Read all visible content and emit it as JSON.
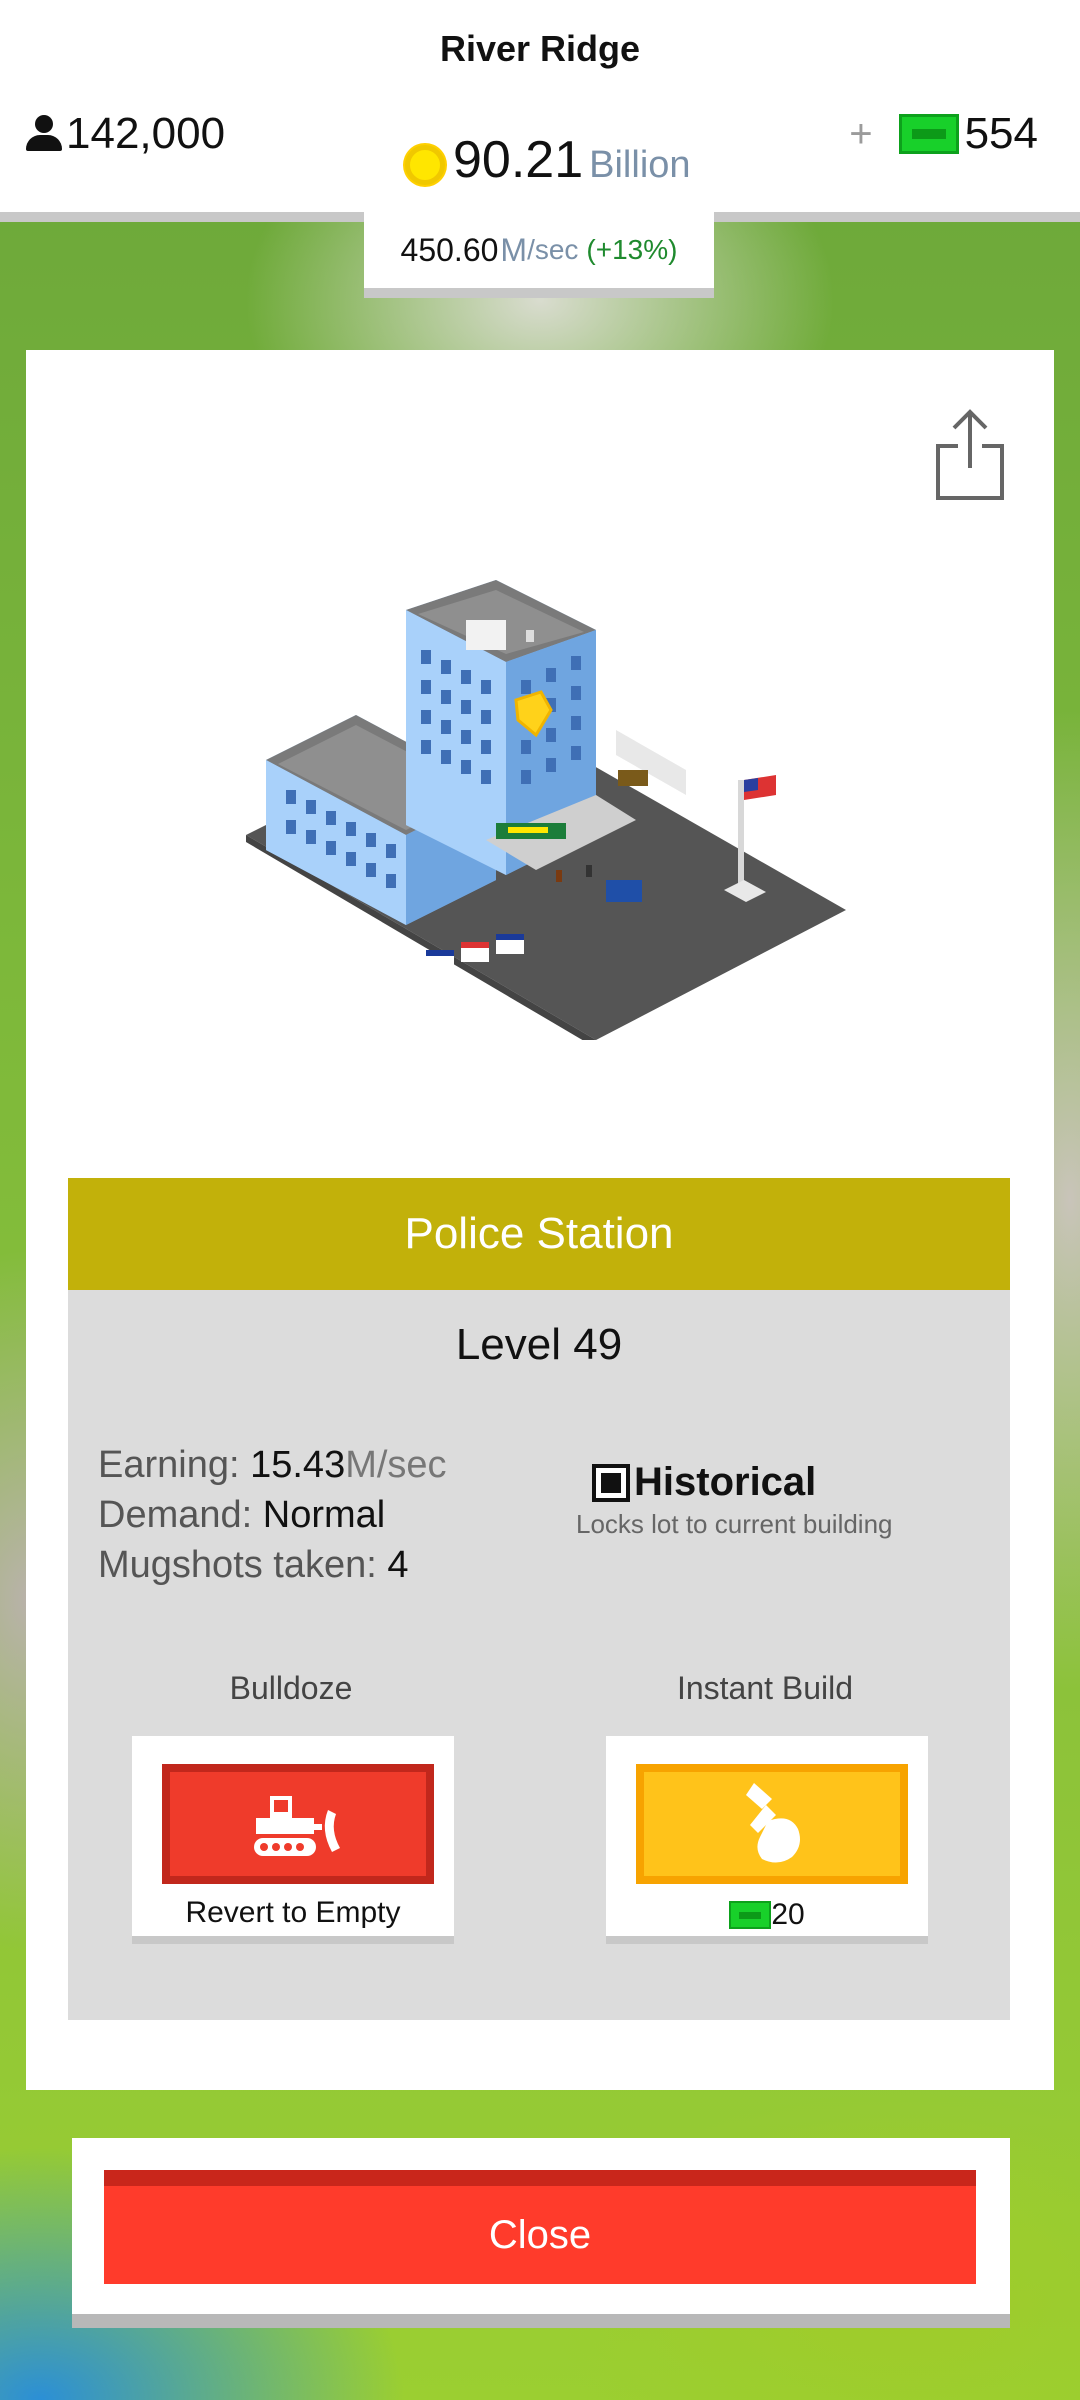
{
  "header": {
    "city_name": "River Ridge",
    "population": "142,000",
    "money_amount": "90.21",
    "money_unit": "Billion",
    "cash": "554",
    "cash_plus": "+",
    "rate_value": "450.60",
    "rate_unit": "M",
    "rate_suffix": "/sec",
    "rate_bonus": "(+13%)"
  },
  "building": {
    "name": "Police Station",
    "level": "Level 49",
    "earning_label": "Earning:",
    "earning_value": "15.43",
    "earning_unit": "M/sec",
    "demand_label": "Demand:",
    "demand_value": "Normal",
    "mugshots_label": "Mugshots taken:",
    "mugshots_value": "4",
    "historical_label": "Historical",
    "historical_desc": "Locks lot to current building"
  },
  "actions": {
    "bulldoze_label": "Bulldoze",
    "bulldoze_caption": "Revert to Empty",
    "instant_label": "Instant Build",
    "instant_cost": "20"
  },
  "close_label": "Close",
  "icons": {
    "population": "person-icon",
    "money": "coin-icon",
    "cash": "bill-icon",
    "share": "share-icon",
    "bulldoze": "bulldozer-icon",
    "instant": "hammer-icon",
    "historical": "checkbox-icon"
  },
  "colors": {
    "title_bar": "#c2b10a",
    "bulldoze": "#ef3b2b",
    "instant": "#ffc31a",
    "close": "#ff3b2b",
    "bill": "#18d02a",
    "coin": "#ffe600"
  }
}
